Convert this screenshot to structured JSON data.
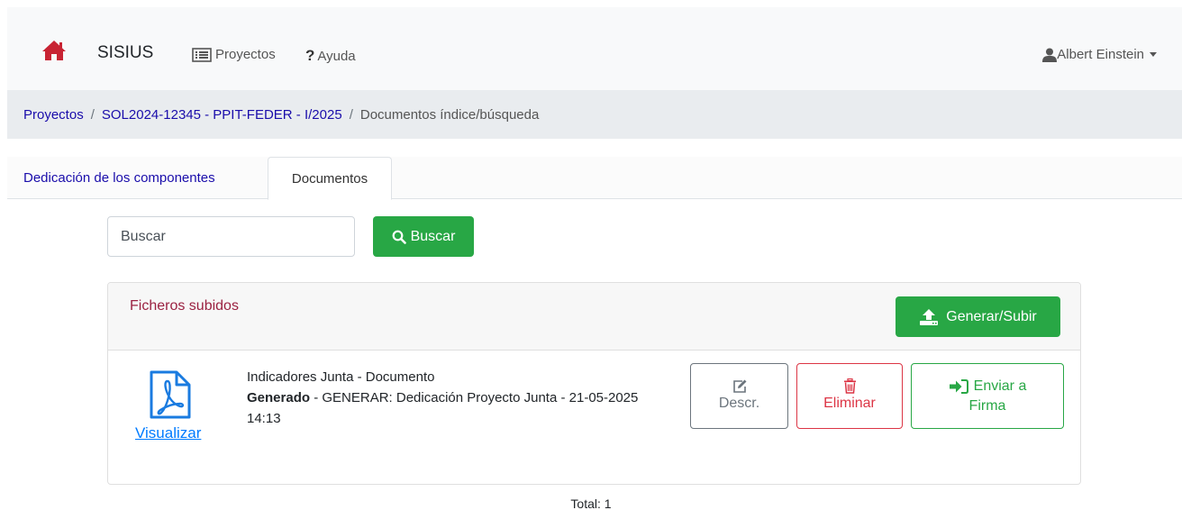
{
  "navbar": {
    "brand": "SISIUS",
    "projects_label": "Proyectos",
    "help_label": "Ayuda",
    "user_name": "Albert Einstein",
    "icons": [
      "home-icon",
      "list-icon",
      "question-icon",
      "user-icon",
      "caret-down-icon"
    ],
    "home_color": "#c82333"
  },
  "breadcrumb": {
    "items": [
      {
        "label": "Proyectos"
      },
      {
        "label": "SOL2024-12345 - PPIT-FEDER - I/2025"
      },
      {
        "label": "Documentos índice/búsqueda"
      }
    ],
    "separator": "/"
  },
  "tabs": [
    {
      "label": "Dedicación de los componentes",
      "active": false
    },
    {
      "label": "Documentos",
      "active": true
    }
  ],
  "search": {
    "placeholder": "Buscar",
    "button_label": "Buscar"
  },
  "files_card": {
    "title": "Ficheros subidos",
    "upload_button_label": "Generar/Subir",
    "files": [
      {
        "name": "Indicadores Junta - Documento",
        "status": "Generado",
        "description": " - GENERAR: Dedicación Proyecto Junta - 21-05-2025 14:13",
        "view_label": "Visualizar",
        "descr_label": "Descr.",
        "delete_label": "Eliminar",
        "send_label_line1": "Enviar a",
        "send_label_line2": "Firma"
      }
    ]
  },
  "total": "Total: 1",
  "colors": {
    "accent_green": "#28a745",
    "danger_red": "#dc3545",
    "link_blue": "#1a0dab",
    "card_title": "#9b2242"
  }
}
